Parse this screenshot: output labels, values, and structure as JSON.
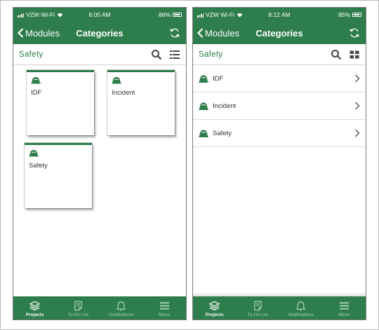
{
  "colors": {
    "brand_green": "#2e7d4c",
    "tab_inactive": "#a9d4b8"
  },
  "left_screen": {
    "status": {
      "carrier": "VZW Wi-Fi",
      "time": "8:05 AM",
      "battery": "86%"
    },
    "nav": {
      "back_label": "Modules",
      "title": "Categories"
    },
    "subbar": {
      "title": "Safety",
      "search_icon": "search-icon",
      "view_toggle_icon": "list-view-icon"
    },
    "tiles": [
      {
        "label": "IDF",
        "icon": "hard-hat-icon"
      },
      {
        "label": "Incident",
        "icon": "hard-hat-icon"
      },
      {
        "label": "Safety",
        "icon": "hard-hat-icon"
      }
    ],
    "tabs": [
      {
        "label": "Projects",
        "icon": "layers-icon",
        "active": true
      },
      {
        "label": "To-Do List",
        "icon": "document-icon",
        "active": false
      },
      {
        "label": "Notifications",
        "icon": "bell-icon",
        "active": false
      },
      {
        "label": "Menu",
        "icon": "menu-icon",
        "active": false
      }
    ]
  },
  "right_screen": {
    "status": {
      "carrier": "VZW Wi-Fi",
      "time": "8:12 AM",
      "battery": "85%"
    },
    "nav": {
      "back_label": "Modules",
      "title": "Categories"
    },
    "subbar": {
      "title": "Safety",
      "search_icon": "search-icon",
      "view_toggle_icon": "grid-view-icon"
    },
    "rows": [
      {
        "label": "IDF",
        "icon": "hard-hat-icon"
      },
      {
        "label": "Incident",
        "icon": "hard-hat-icon"
      },
      {
        "label": "Safety",
        "icon": "hard-hat-icon"
      }
    ],
    "tabs": [
      {
        "label": "Projects",
        "icon": "layers-icon",
        "active": true
      },
      {
        "label": "To-Do List",
        "icon": "document-icon",
        "active": false
      },
      {
        "label": "Notifications",
        "icon": "bell-icon",
        "active": false
      },
      {
        "label": "Menu",
        "icon": "menu-icon",
        "active": false
      }
    ]
  }
}
